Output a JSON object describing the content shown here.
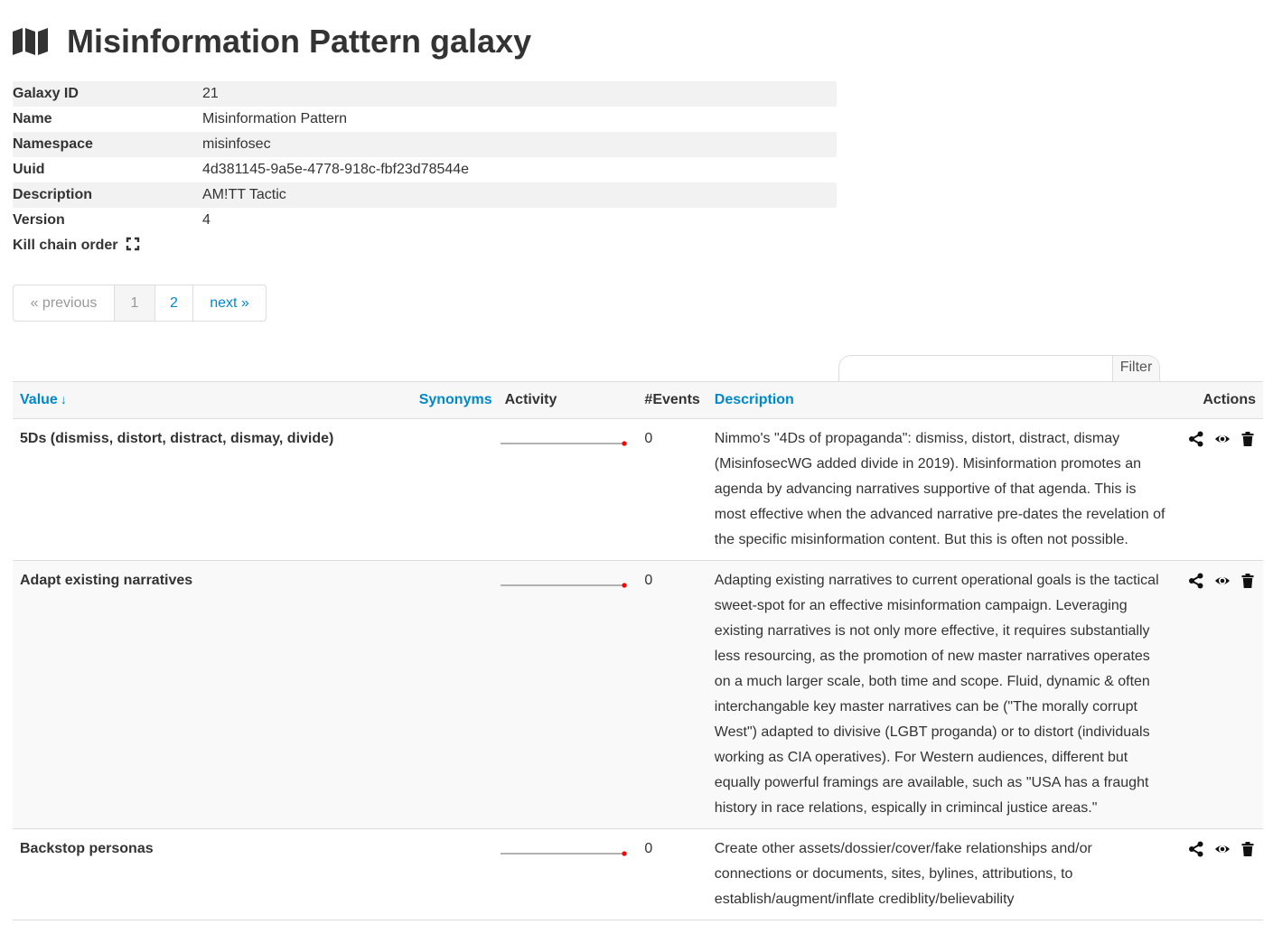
{
  "header": {
    "title": "Misinformation Pattern galaxy",
    "icon": "map-icon"
  },
  "info": [
    {
      "label": "Galaxy ID",
      "value": "21"
    },
    {
      "label": "Name",
      "value": "Misinformation Pattern"
    },
    {
      "label": "Namespace",
      "value": "misinfosec"
    },
    {
      "label": "Uuid",
      "value": "4d381145-9a5e-4778-918c-fbf23d78544e"
    },
    {
      "label": "Description",
      "value": "AM!TT Tactic"
    },
    {
      "label": "Version",
      "value": "4"
    },
    {
      "label": "Kill chain order",
      "value": ""
    }
  ],
  "pagination": {
    "previous": "« previous",
    "pages": [
      "1",
      "2"
    ],
    "current_page": "1",
    "next": "next »"
  },
  "filter": {
    "label": "Filter",
    "value": "",
    "placeholder": ""
  },
  "table": {
    "columns": {
      "value": "Value",
      "value_sort_indicator": "↓",
      "synonyms": "Synonyms",
      "activity": "Activity",
      "events": "#Events",
      "description": "Description",
      "actions": "Actions"
    },
    "rows": [
      {
        "value": "5Ds (dismiss, distort, distract, dismay, divide)",
        "synonyms": "",
        "activity": [
          0,
          0,
          0,
          0
        ],
        "events": "0",
        "description": "Nimmo's \"4Ds of propaganda\": dismiss, distort, distract, dismay (MisinfosecWG added divide in 2019). Misinformation promotes an agenda by advancing narratives supportive of that agenda. This is most effective when the advanced narrative pre-dates the revelation of the specific misinformation content. But this is often not possible."
      },
      {
        "value": "Adapt existing narratives",
        "synonyms": "",
        "activity": [
          0,
          0,
          0,
          0
        ],
        "events": "0",
        "description": "Adapting existing narratives to current operational goals is the tactical sweet-spot for an effective misinformation campaign. Leveraging existing narratives is not only more effective, it requires substantially less resourcing, as the promotion of new master narratives operates on a much larger scale, both time and scope. Fluid, dynamic & often interchangable key master narratives can be (\"The morally corrupt West\") adapted to divisive (LGBT proganda) or to distort (individuals working as CIA operatives). For Western audiences, different but equally powerful framings are available, such as \"USA has a fraught history in race relations, espically in crimincal justice areas.\""
      },
      {
        "value": "Backstop personas",
        "synonyms": "",
        "activity": [
          0,
          0,
          0,
          0
        ],
        "events": "0",
        "description": "Create other assets/dossier/cover/fake relationships and/or connections or documents, sites, bylines, attributions, to establish/augment/inflate crediblity/believability"
      }
    ],
    "row_actions": [
      "share-icon",
      "eye-icon",
      "trash-icon"
    ]
  },
  "colors": {
    "link": "#0088cc",
    "text": "#333333",
    "sparkline_line": "#999999",
    "sparkline_dot": "#ff0000"
  }
}
